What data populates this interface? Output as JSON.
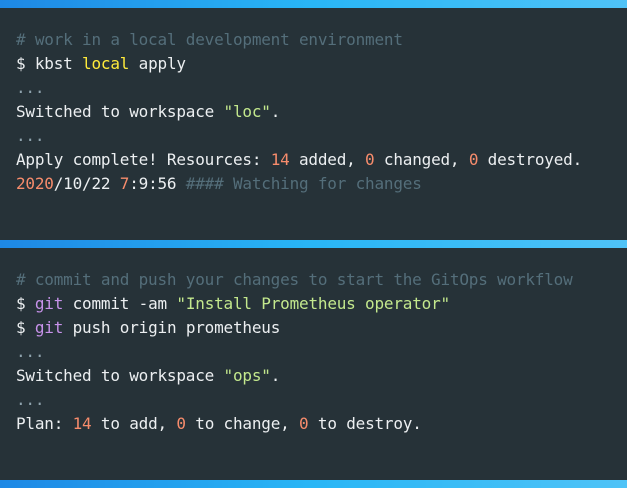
{
  "panel1": {
    "comment": "# work in a local development environment",
    "cmd_prompt": "$ ",
    "cmd_name": "kbst ",
    "cmd_keyword": "local",
    "cmd_arg": " apply",
    "ellipsis1": "...",
    "switched_prefix": "Switched to workspace ",
    "switched_workspace": "\"loc\"",
    "switched_suffix": ".",
    "ellipsis2": "...",
    "apply_prefix": "Apply complete! Resources: ",
    "added_count": "14",
    "added_label": " added, ",
    "changed_count": "0",
    "changed_label": " changed, ",
    "destroyed_count": "0",
    "destroyed_label": " destroyed.",
    "ts_date": "2020",
    "ts_rest": "/10/22 ",
    "ts_hour": "7",
    "ts_time": ":9:56",
    "watching": " #### Watching for changes"
  },
  "panel2": {
    "comment": "# commit and push your changes to start the GitOps workflow",
    "git1_prompt": "$ ",
    "git1_keyword": "git",
    "git1_args": " commit -am ",
    "git1_message": "\"Install Prometheus operator\"",
    "git2_prompt": "$ ",
    "git2_keyword": "git",
    "git2_args": " push origin prometheus",
    "ellipsis1": "...",
    "switched_prefix": "Switched to workspace ",
    "switched_workspace": "\"ops\"",
    "switched_suffix": ".",
    "ellipsis2": "...",
    "plan_prefix": "Plan: ",
    "add_count": "14",
    "add_label": " to add, ",
    "change_count": "0",
    "change_label": " to change, ",
    "destroy_count": "0",
    "destroy_label": " to destroy."
  },
  "colors": {
    "background": "#263238",
    "accent_bar": "#29b6f6",
    "comment": "#546e7a",
    "keyword": "#ffeb3b",
    "git_keyword": "#c792ea",
    "string": "#c3e88d",
    "number": "#f78c6c"
  }
}
